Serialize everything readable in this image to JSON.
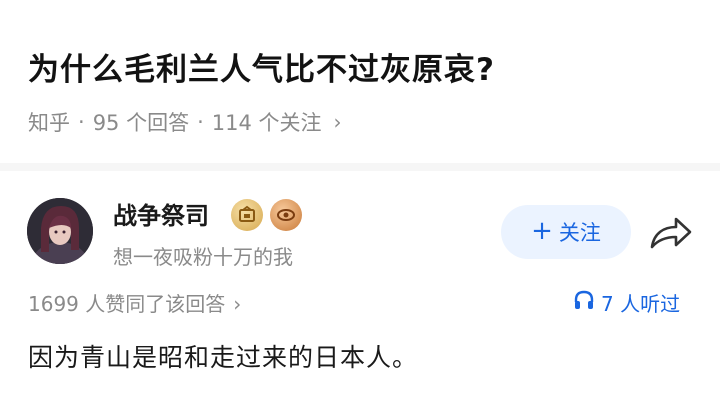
{
  "question": {
    "title": "为什么毛利兰人气比不过灰原哀?",
    "source": "知乎",
    "separator": "·",
    "answers": "95 个回答",
    "followers": "114 个关注",
    "chevron": "›"
  },
  "author": {
    "name": "战争祭司",
    "bio": "想一夜吸粉十万的我",
    "follow_plus": "+",
    "follow_label": "关注",
    "badges": [
      "gold-badge-icon",
      "orange-badge-icon"
    ]
  },
  "stats": {
    "votes": "1699 人赞同了该回答",
    "votes_chevron": "›",
    "listeners": "7 人听过"
  },
  "answer": {
    "text": "因为青山是昭和走过来的日本人。"
  },
  "colors": {
    "accent": "#1a66e0",
    "meta_gray": "#8a8a8a",
    "follow_bg": "#ebf3ff"
  }
}
